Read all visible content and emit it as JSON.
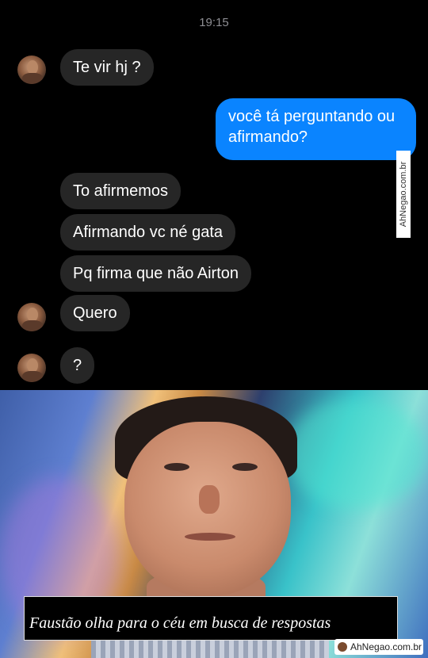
{
  "status": {
    "time": "19:15"
  },
  "messages": [
    {
      "from": "in",
      "text": "Te vir hj ?"
    },
    {
      "from": "out",
      "text": "você tá perguntando ou afirmando?"
    },
    {
      "from": "in",
      "text": "To afirmemos"
    },
    {
      "from": "in",
      "text": "Afirmando vc né gata"
    },
    {
      "from": "in",
      "text": "Pq firma que não Airton"
    },
    {
      "from": "in",
      "text": "Quero"
    },
    {
      "from": "in",
      "text": "?"
    }
  ],
  "colors": {
    "background": "#000000",
    "incoming_bubble": "#262626",
    "outgoing_bubble": "#0a84ff",
    "text": "#ffffff",
    "time": "#8e8e93"
  },
  "meme": {
    "caption": "Faustão olha para o céu em busca de respostas"
  },
  "watermark": {
    "side": "AhNegao.com.br",
    "bottom": "AhNegao.com.br"
  }
}
